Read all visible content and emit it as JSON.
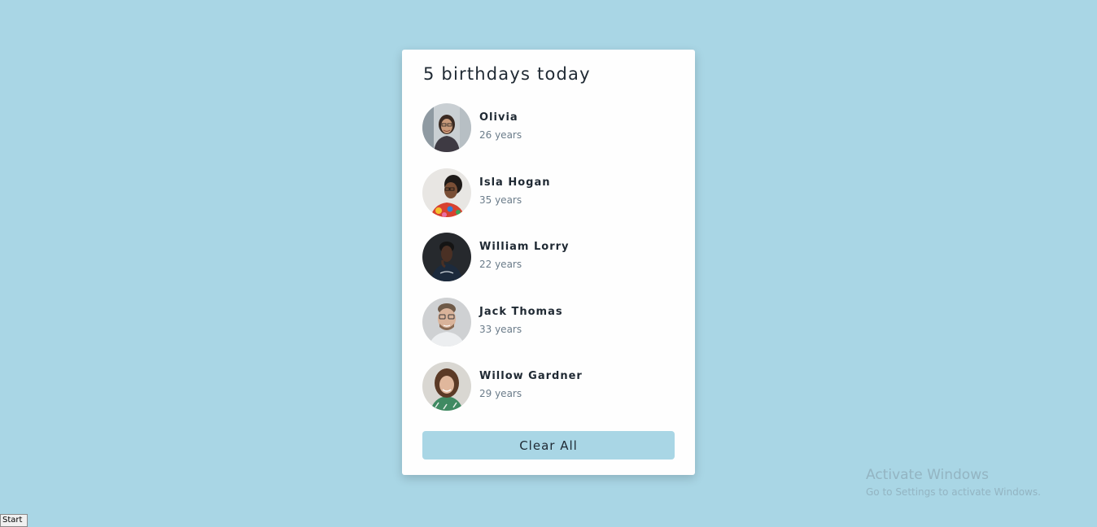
{
  "card": {
    "title": "5 birthdays today",
    "people": [
      {
        "name": "Olivia",
        "age": "26 years"
      },
      {
        "name": "Isla Hogan",
        "age": "35 years"
      },
      {
        "name": "William Lorry",
        "age": "22 years"
      },
      {
        "name": "Jack Thomas",
        "age": "33 years"
      },
      {
        "name": "Willow Gardner",
        "age": "29 years"
      }
    ],
    "clear_label": "Clear All"
  },
  "watermark": {
    "title": "Activate Windows",
    "subtitle": "Go to Settings to activate Windows."
  },
  "taskbar": {
    "start_label": "Start"
  },
  "colors": {
    "background": "#a9d6e5",
    "card": "#fefefe",
    "button": "#a9d6e5",
    "text_dark": "#1f2933",
    "text_muted": "#6b7c8a"
  }
}
